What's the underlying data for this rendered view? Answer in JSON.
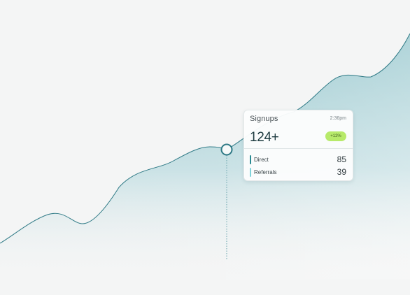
{
  "tooltip": {
    "title": "Signups",
    "time": "2:36pm",
    "value": "124+",
    "change": "+12%",
    "rows": [
      {
        "label": "Direct",
        "value": "85"
      },
      {
        "label": "Referrals",
        "value": "39"
      }
    ]
  },
  "colors": {
    "background": "#f4f5f5",
    "area_top": "#9fcbd1",
    "line": "#2f7a86",
    "direct_bar": "#2a8a92",
    "referrals_bar": "#7fd3da",
    "badge": "#b7ea6a"
  },
  "chart_data": {
    "type": "area",
    "title": "",
    "xlabel": "",
    "ylabel": "",
    "series": [
      {
        "values": [
          55,
          57,
          62,
          68,
          72,
          76,
          75,
          79,
          80,
          83,
          85,
          90,
          92,
          93
        ]
      }
    ],
    "highlighted_index": 10,
    "grid": false
  }
}
